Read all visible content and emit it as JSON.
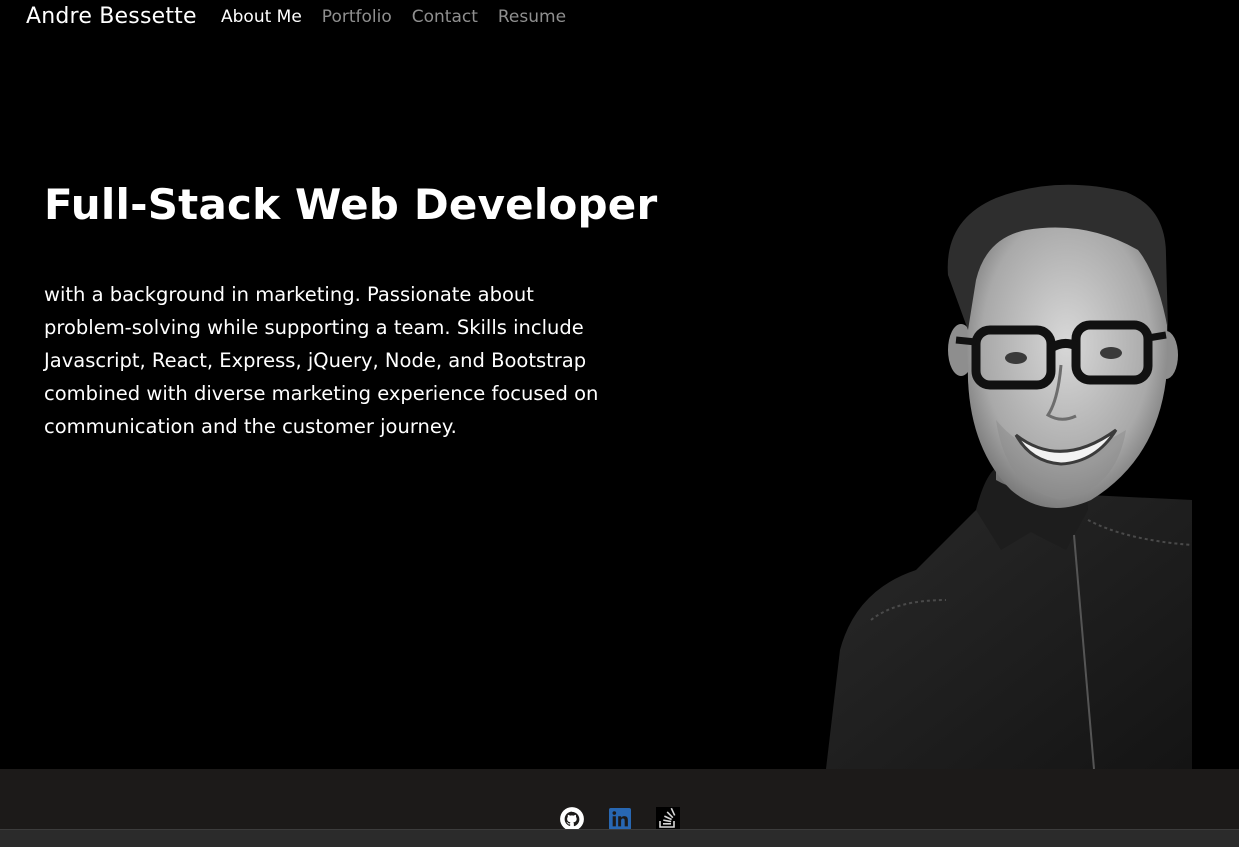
{
  "nav": {
    "brand": "Andre Bessette",
    "links": [
      {
        "label": "About Me",
        "active": true
      },
      {
        "label": "Portfolio",
        "active": false
      },
      {
        "label": "Contact",
        "active": false
      },
      {
        "label": "Resume",
        "active": false
      }
    ]
  },
  "hero": {
    "title": "Full-Stack Web Developer",
    "description": "with a background in marketing. Passionate about problem-solving while supporting a team. Skills include Javascript, React, Express, jQuery, Node, and Bootstrap combined with diverse marketing experience focused on communication and the customer journey."
  },
  "footer": {
    "social": [
      {
        "icon": "github-icon"
      },
      {
        "icon": "linkedin-icon"
      },
      {
        "icon": "stackoverflow-icon"
      }
    ]
  },
  "colors": {
    "background": "#000000",
    "nav_inactive": "#8f8f8f",
    "footer_bg": "#1c1a19",
    "linkedin_blue": "#2867b2"
  }
}
